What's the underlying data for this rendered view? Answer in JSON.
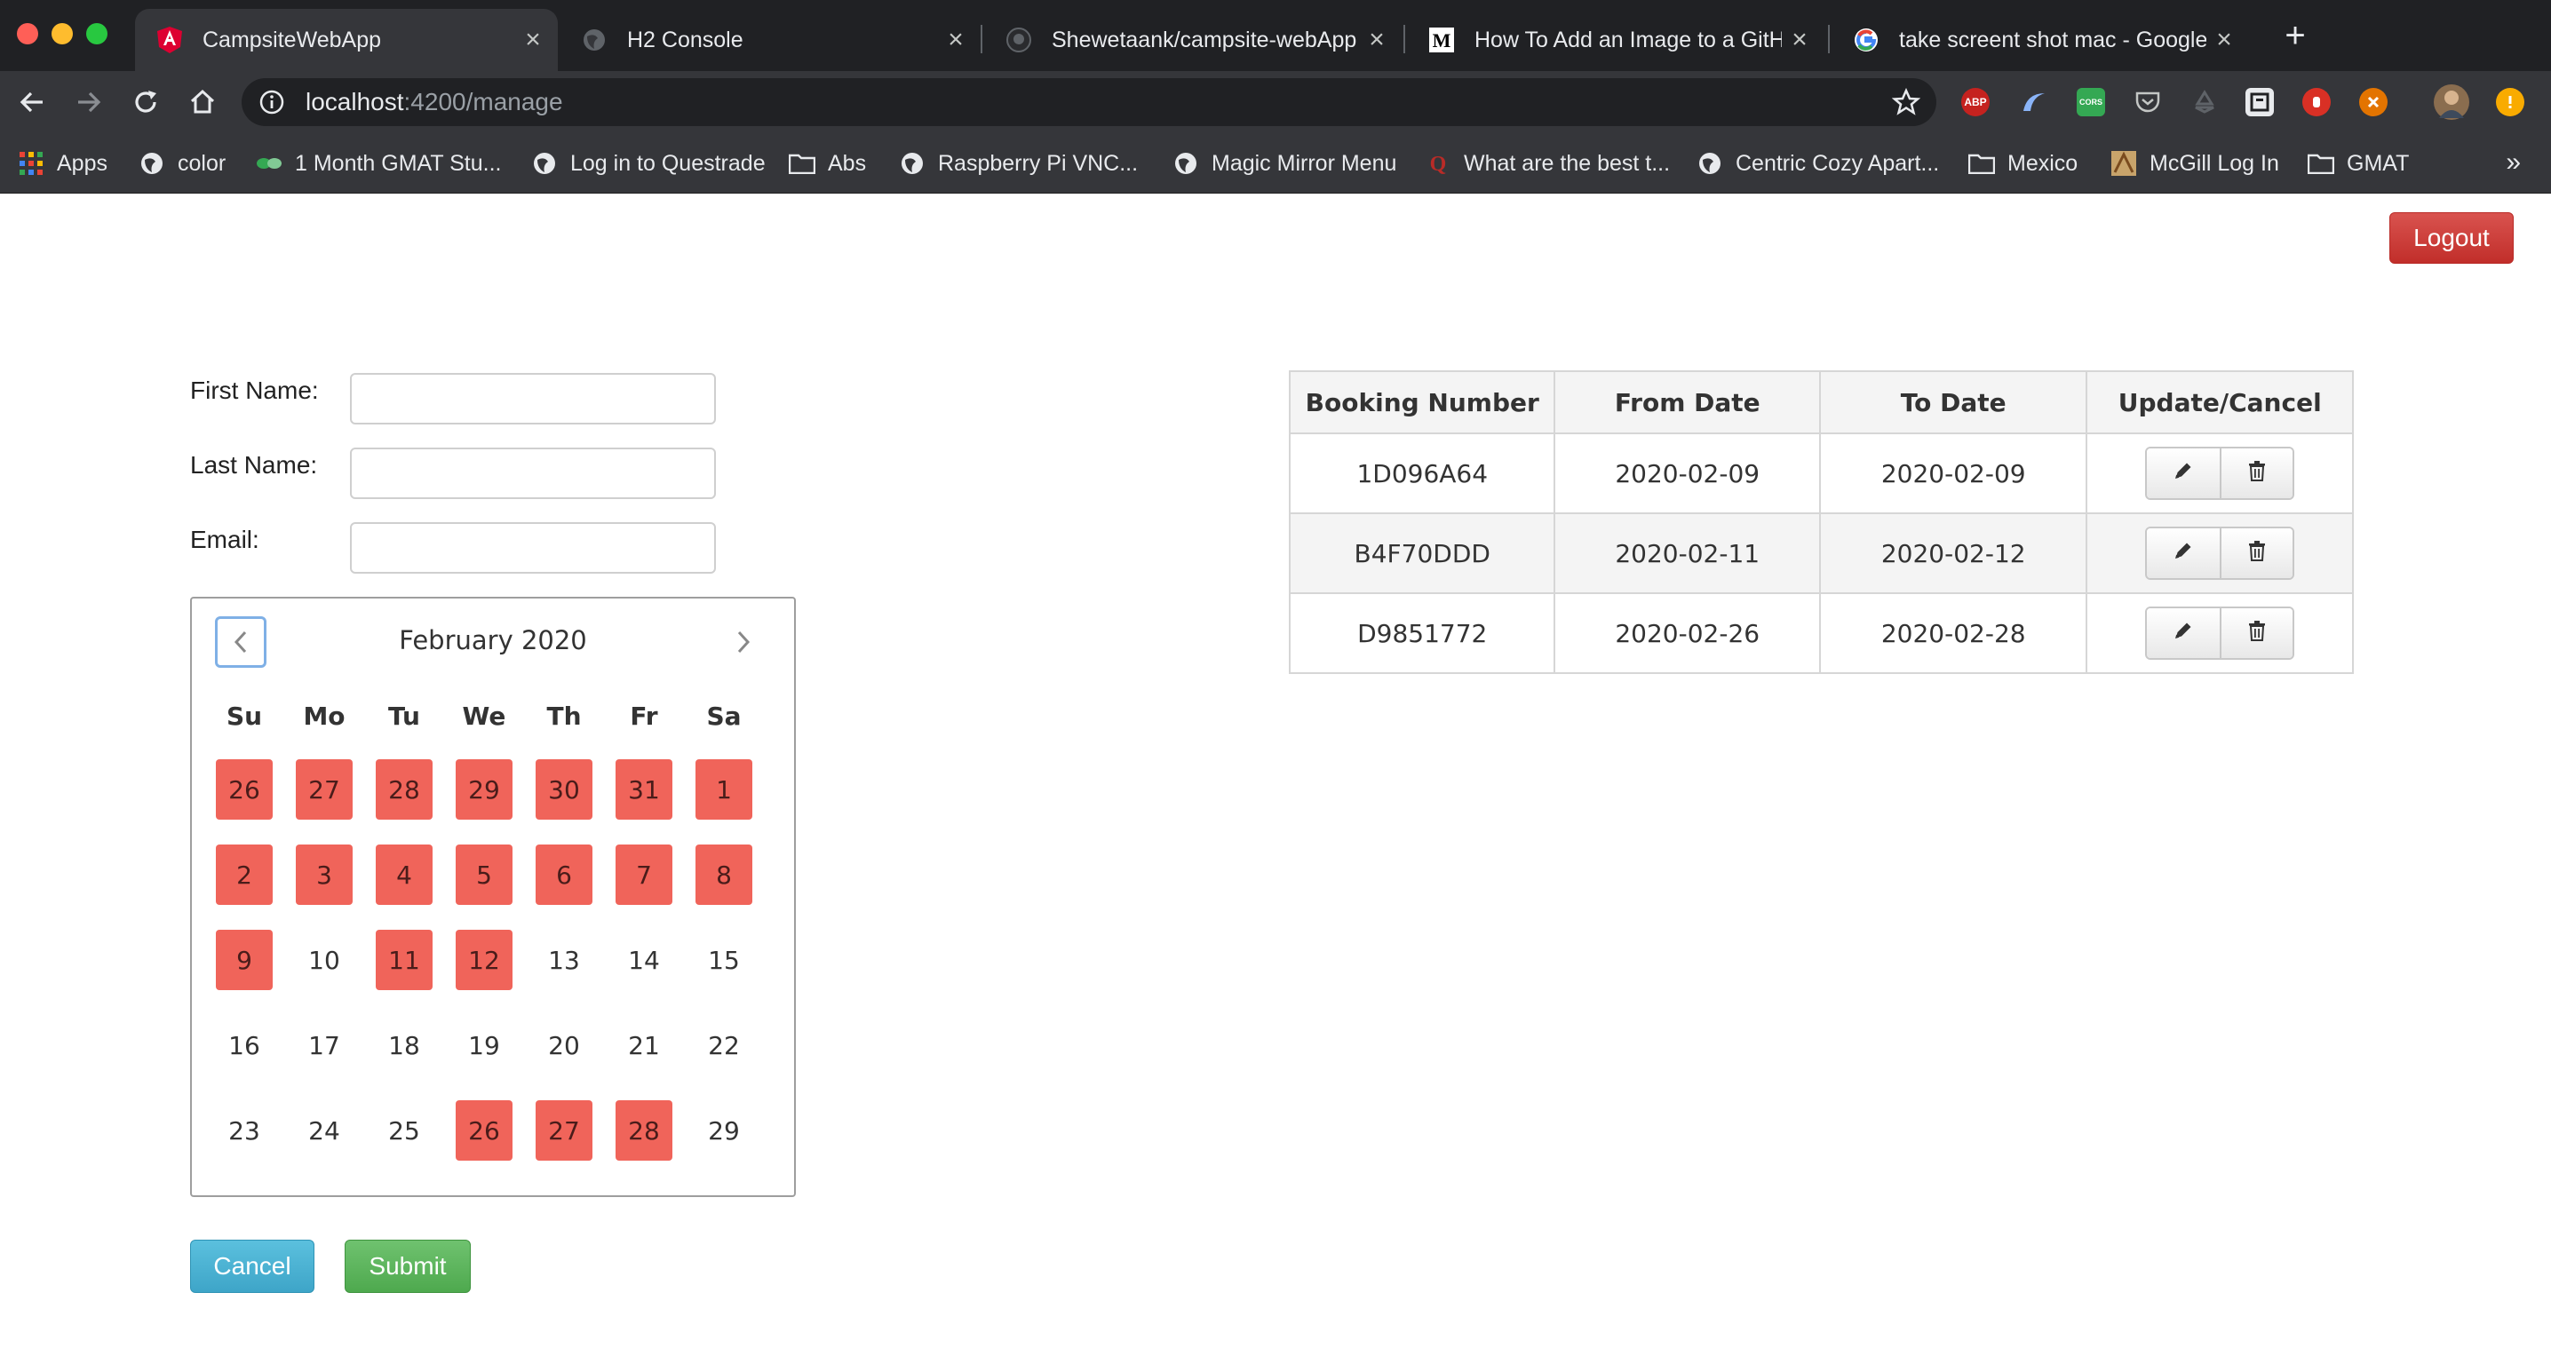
{
  "browser": {
    "tabs": [
      {
        "title": "CampsiteWebApp",
        "icon": "angular-icon",
        "active": true
      },
      {
        "title": "H2 Console",
        "icon": "globe-icon",
        "active": false
      },
      {
        "title": "Shewetaank/campsite-webApp",
        "icon": "github-icon",
        "active": false
      },
      {
        "title": "How To Add an Image to a GitHu",
        "icon": "medium-icon",
        "active": false
      },
      {
        "title": "take screent shot mac - Google S",
        "icon": "google-icon",
        "active": false
      }
    ],
    "url": {
      "host": "localhost",
      "path": ":4200/manage"
    },
    "bookmarks": [
      {
        "label": "Apps",
        "icon": "apps-grid-icon"
      },
      {
        "label": "color",
        "icon": "globe-icon"
      },
      {
        "label": "1 Month GMAT Stu...",
        "icon": "gmat-icon"
      },
      {
        "label": "Log in to Questrade",
        "icon": "globe-icon"
      },
      {
        "label": "Abs",
        "icon": "folder-icon"
      },
      {
        "label": "Raspberry Pi VNC...",
        "icon": "globe-icon"
      },
      {
        "label": "Magic Mirror Menu",
        "icon": "globe-icon"
      },
      {
        "label": "What are the best t...",
        "icon": "quora-icon"
      },
      {
        "label": "Centric Cozy Apart...",
        "icon": "globe-icon"
      },
      {
        "label": "Mexico",
        "icon": "folder-icon"
      },
      {
        "label": "McGill Log In",
        "icon": "mcgill-icon"
      },
      {
        "label": "GMAT",
        "icon": "folder-icon"
      }
    ],
    "extensions": [
      "ABP",
      "CORS"
    ]
  },
  "header": {
    "logout_label": "Logout"
  },
  "form": {
    "first_name_label": "First Name:",
    "last_name_label": "Last Name:",
    "email_label": "Email:",
    "first_name_value": "",
    "last_name_value": "",
    "email_value": ""
  },
  "calendar": {
    "month_label": "February 2020",
    "weekdays": [
      "Su",
      "Mo",
      "Tu",
      "We",
      "Th",
      "Fr",
      "Sa"
    ],
    "weeks": [
      [
        {
          "d": "26",
          "booked": true
        },
        {
          "d": "27",
          "booked": true
        },
        {
          "d": "28",
          "booked": true
        },
        {
          "d": "29",
          "booked": true
        },
        {
          "d": "30",
          "booked": true
        },
        {
          "d": "31",
          "booked": true
        },
        {
          "d": "1",
          "booked": true
        }
      ],
      [
        {
          "d": "2",
          "booked": true
        },
        {
          "d": "3",
          "booked": true
        },
        {
          "d": "4",
          "booked": true
        },
        {
          "d": "5",
          "booked": true
        },
        {
          "d": "6",
          "booked": true
        },
        {
          "d": "7",
          "booked": true
        },
        {
          "d": "8",
          "booked": true
        }
      ],
      [
        {
          "d": "9",
          "booked": true
        },
        {
          "d": "10",
          "booked": false
        },
        {
          "d": "11",
          "booked": true
        },
        {
          "d": "12",
          "booked": true
        },
        {
          "d": "13",
          "booked": false
        },
        {
          "d": "14",
          "booked": false
        },
        {
          "d": "15",
          "booked": false
        }
      ],
      [
        {
          "d": "16",
          "booked": false
        },
        {
          "d": "17",
          "booked": false
        },
        {
          "d": "18",
          "booked": false
        },
        {
          "d": "19",
          "booked": false
        },
        {
          "d": "20",
          "booked": false
        },
        {
          "d": "21",
          "booked": false
        },
        {
          "d": "22",
          "booked": false
        }
      ],
      [
        {
          "d": "23",
          "booked": false
        },
        {
          "d": "24",
          "booked": false
        },
        {
          "d": "25",
          "booked": false
        },
        {
          "d": "26",
          "booked": true
        },
        {
          "d": "27",
          "booked": true
        },
        {
          "d": "28",
          "booked": true
        },
        {
          "d": "29",
          "booked": false
        }
      ]
    ],
    "booked_color": "#f0645a"
  },
  "actions": {
    "cancel_label": "Cancel",
    "submit_label": "Submit"
  },
  "bookings_table": {
    "headers": [
      "Booking Number",
      "From Date",
      "To Date",
      "Update/Cancel"
    ],
    "rows": [
      {
        "booking_number": "1D096A64",
        "from_date": "2020-02-09",
        "to_date": "2020-02-09"
      },
      {
        "booking_number": "B4F70DDD",
        "from_date": "2020-02-11",
        "to_date": "2020-02-12"
      },
      {
        "booking_number": "D9851772",
        "from_date": "2020-02-26",
        "to_date": "2020-02-28"
      }
    ],
    "row_actions": [
      "pencil-icon",
      "trash-icon"
    ]
  }
}
